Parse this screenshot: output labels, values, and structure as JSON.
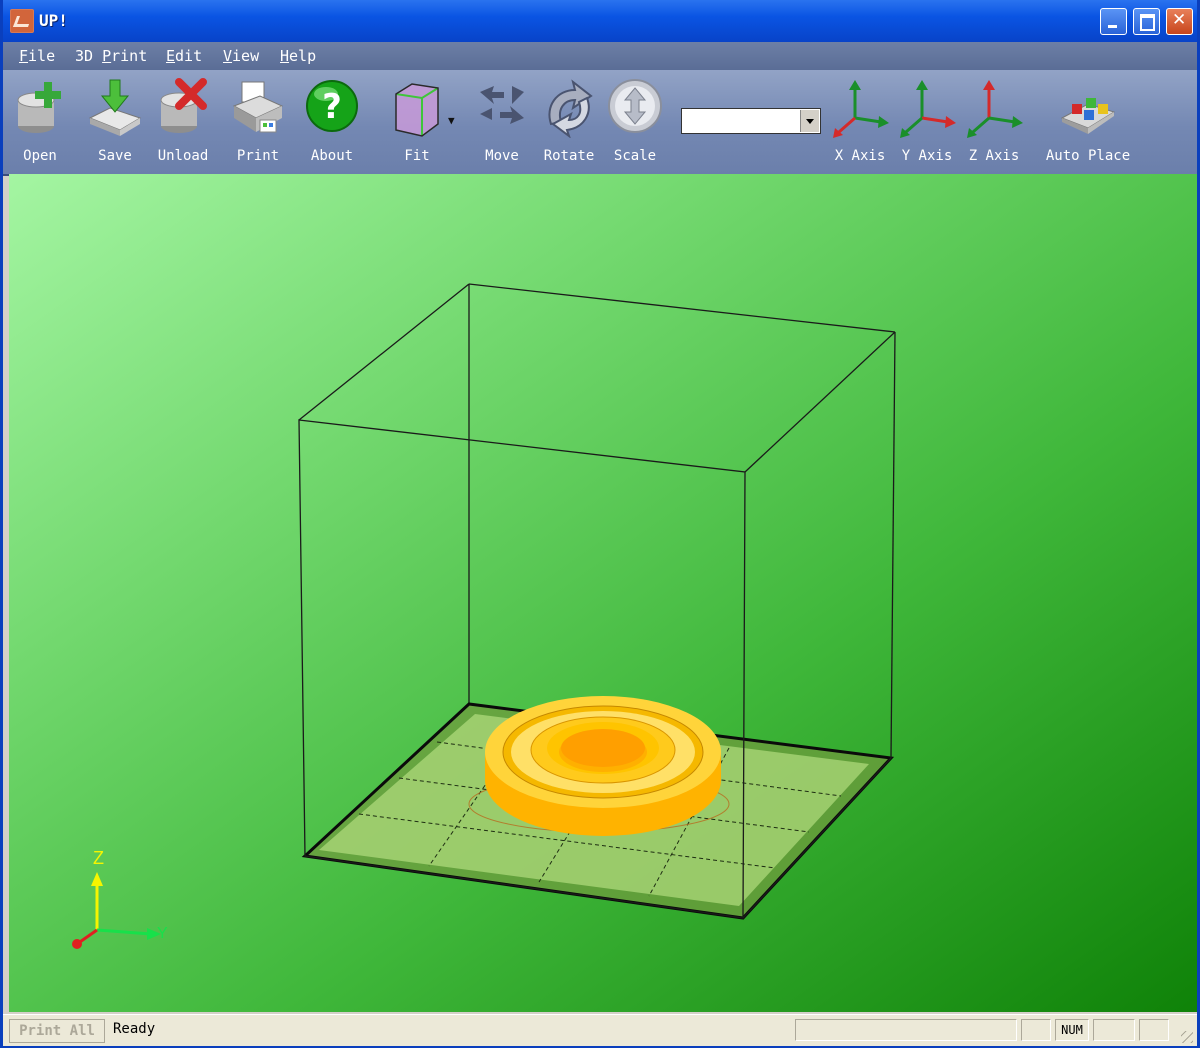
{
  "window": {
    "title": "UP!"
  },
  "menu": [
    {
      "accel": "F",
      "rest": "ile"
    },
    {
      "pre": "3D ",
      "accel": "P",
      "rest": "rint"
    },
    {
      "accel": "E",
      "rest": "dit"
    },
    {
      "accel": "V",
      "rest": "iew"
    },
    {
      "accel": "H",
      "rest": "elp"
    }
  ],
  "toolbar": {
    "open": "Open",
    "save": "Save",
    "unload": "Unload",
    "print": "Print",
    "about": "About",
    "fit": "Fit",
    "move": "Move",
    "rotate": "Rotate",
    "scale": "Scale",
    "combo_value": "",
    "x_axis": "X Axis",
    "y_axis": "Y Axis",
    "z_axis": "Z Axis",
    "auto_place": "Auto Place"
  },
  "viewport": {
    "axis_z": "Z",
    "axis_y": "Y"
  },
  "status": {
    "print_all": "Print All",
    "text": "Ready",
    "num": "NUM"
  },
  "colors": {
    "title_bar": "#0a54e3",
    "menu_bar": "#5a6d96",
    "model": "#ffbf00",
    "viewport_green": "#3fb73a"
  }
}
